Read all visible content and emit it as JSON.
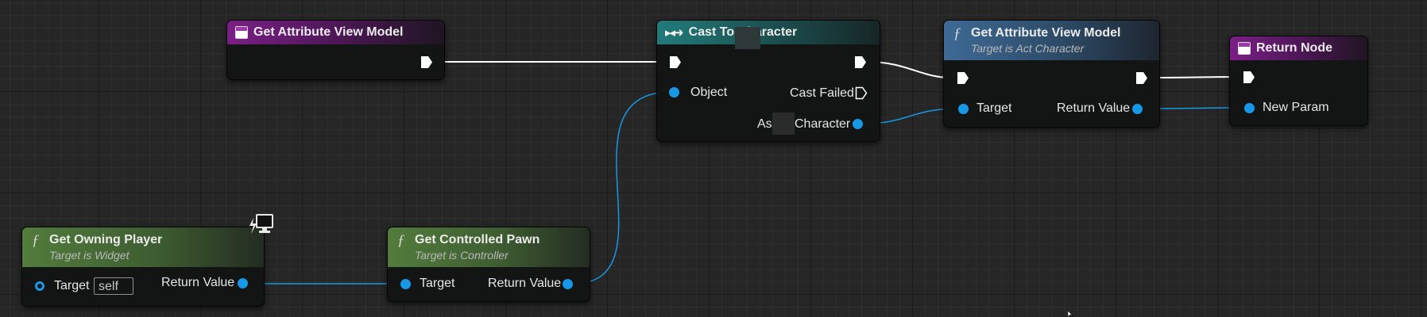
{
  "nodes": {
    "get_attr_vm_event": {
      "title": "Get Attribute View Model"
    },
    "cast_to": {
      "title": "Cast To Character",
      "pin_object": "Object",
      "pin_cast_failed": "Cast Failed",
      "pin_as_prefix": "As",
      "pin_as_suffix": "Character"
    },
    "get_attr_vm_fn": {
      "title": "Get Attribute View Model",
      "subtitle": "Target is Act Character",
      "pin_target": "Target",
      "pin_return": "Return Value"
    },
    "return_node": {
      "title": "Return Node",
      "pin_new_param": "New Param"
    },
    "get_owning_player": {
      "title": "Get Owning Player",
      "subtitle": "Target is Widget",
      "pin_target": "Target",
      "target_default": "self",
      "pin_return": "Return Value"
    },
    "get_controlled_pawn": {
      "title": "Get Controlled Pawn",
      "subtitle": "Target is Controller",
      "pin_target": "Target",
      "pin_return": "Return Value"
    }
  },
  "colors": {
    "exec_wire": "#ffffff",
    "object_wire": "#1798e6",
    "purple_header": "#7a1f86",
    "teal_header": "#237b7b",
    "blue_header": "#3e6a95",
    "green_header": "#527c3c"
  },
  "icons": {
    "function": "function-icon",
    "event": "event-icon",
    "cast": "cast-icon",
    "network": "network-icon"
  }
}
